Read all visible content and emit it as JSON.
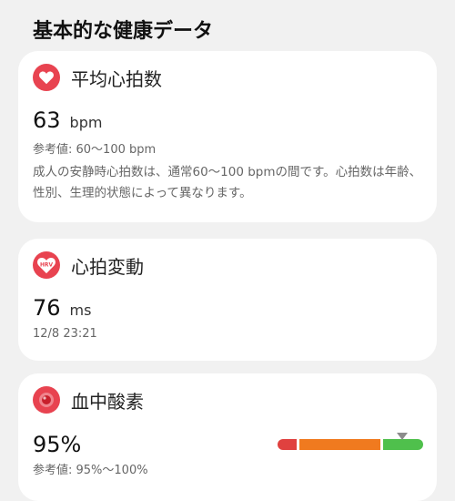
{
  "section": {
    "title": "基本的な健康データ"
  },
  "avg_heart_rate": {
    "icon": "heart-icon",
    "title": "平均心拍数",
    "value": "63",
    "unit": "bpm",
    "reference": "参考値:  60～100 bpm",
    "description": "成人の安静時心拍数は、通常60～100 bpmの間です。心拍数は年齢、性別、生理的状態によって異なります。"
  },
  "hrv": {
    "icon": "hrv-heart-icon",
    "icon_text": "HRV",
    "title": "心拍変動",
    "value": "76",
    "unit": "ms",
    "timestamp": "12/8 23:21"
  },
  "spo2": {
    "icon": "blood-oxygen-icon",
    "title": "血中酸素",
    "value": "95%",
    "reference": "参考値:  95%～100%",
    "level_percent": 95,
    "colors": {
      "low": "#e0413f",
      "mid": "#f07a1f",
      "normal": "#4fc04c",
      "marker": "#8c8c8c"
    }
  },
  "accent_color": "#e84350"
}
